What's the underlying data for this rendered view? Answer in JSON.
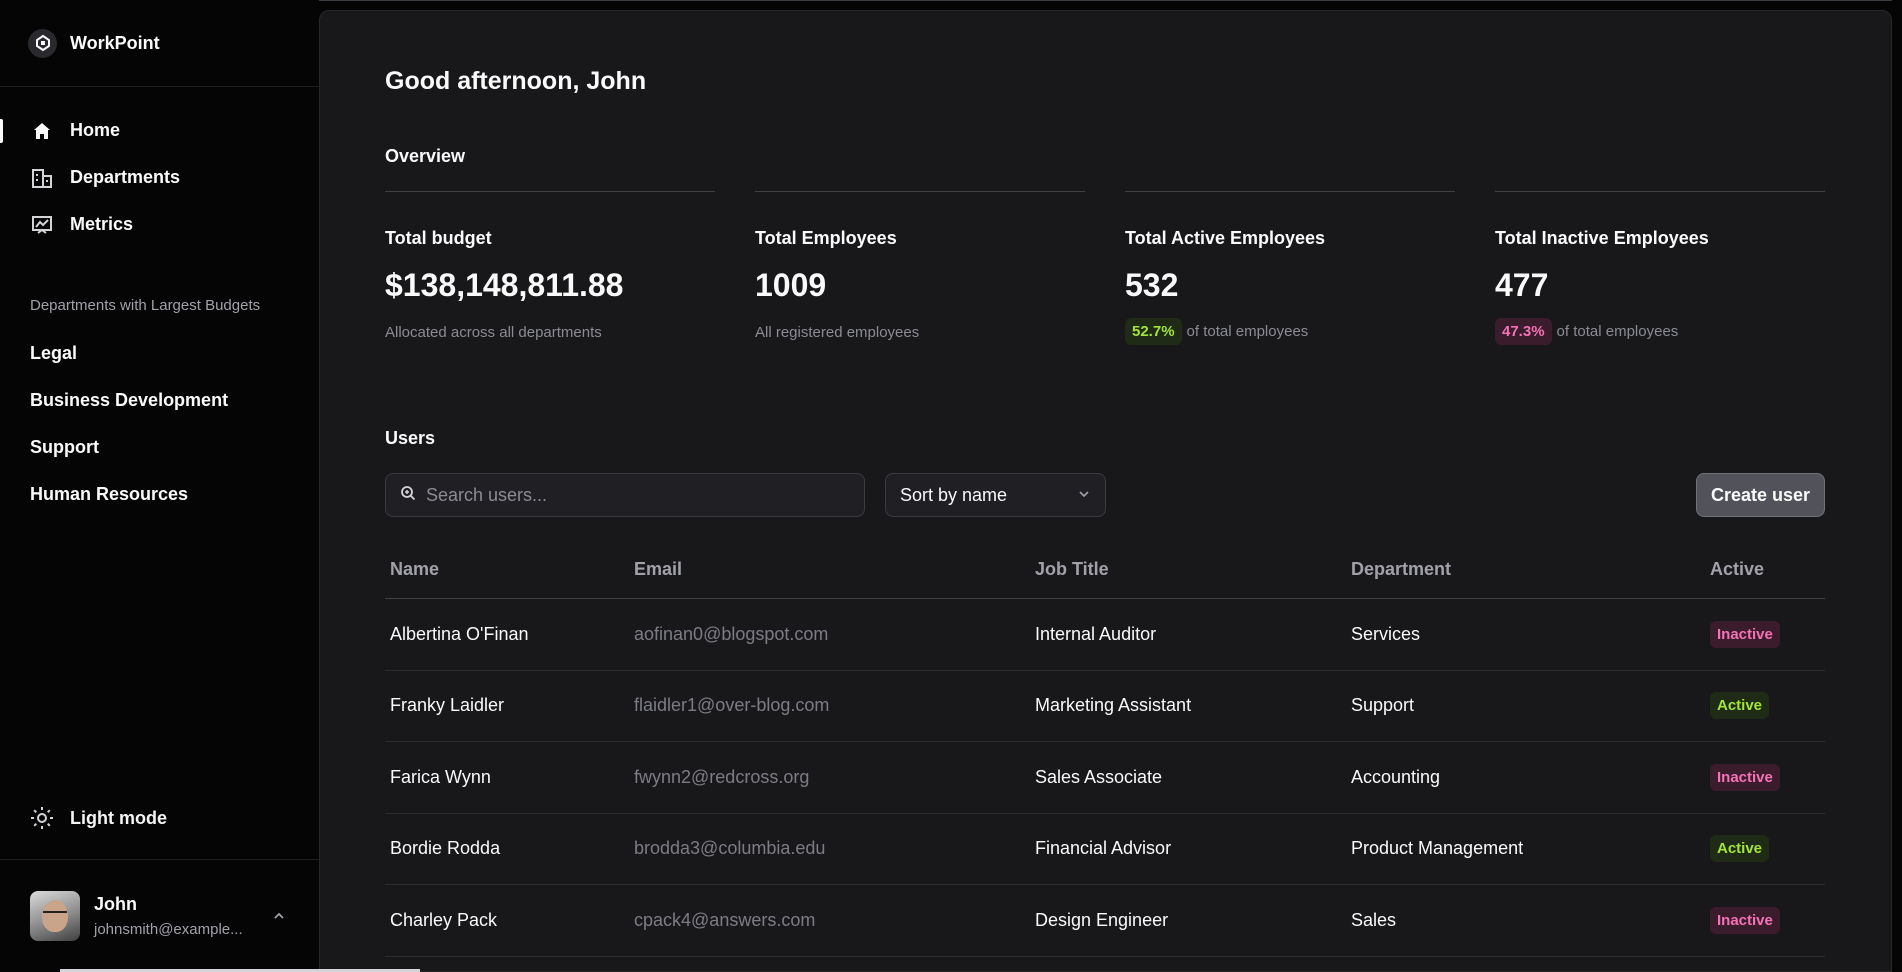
{
  "app": {
    "name": "WorkPoint"
  },
  "nav": [
    {
      "label": "Home",
      "icon": "home-icon",
      "active": true
    },
    {
      "label": "Departments",
      "icon": "building-icon",
      "active": false
    },
    {
      "label": "Metrics",
      "icon": "chart-icon",
      "active": false
    }
  ],
  "sidebar": {
    "section_title": "Departments with Largest Budgets",
    "departments": [
      "Legal",
      "Business Development",
      "Support",
      "Human Resources"
    ],
    "theme_toggle": "Light mode",
    "user": {
      "name": "John",
      "email": "johnsmith@example..."
    }
  },
  "main": {
    "greeting": "Good afternoon, John",
    "overview_title": "Overview",
    "stats": [
      {
        "label": "Total budget",
        "value": "$138,148,811.88",
        "sub": "Allocated across all departments"
      },
      {
        "label": "Total Employees",
        "value": "1009",
        "sub": "All registered employees"
      },
      {
        "label": "Total Active Employees",
        "value": "532",
        "pct": "52.7%",
        "sub": "of total employees"
      },
      {
        "label": "Total Inactive Employees",
        "value": "477",
        "pct": "47.3%",
        "sub": "of total employees"
      }
    ],
    "users_title": "Users",
    "search_placeholder": "Search users...",
    "sort_label": "Sort by name",
    "create_button": "Create user",
    "table": {
      "headers": [
        "Name",
        "Email",
        "Job Title",
        "Department",
        "Active"
      ],
      "rows": [
        {
          "name": "Albertina O'Finan",
          "email": "aofinan0@blogspot.com",
          "job": "Internal Auditor",
          "dept": "Services",
          "status": "Inactive"
        },
        {
          "name": "Franky Laidler",
          "email": "flaidler1@over-blog.com",
          "job": "Marketing Assistant",
          "dept": "Support",
          "status": "Active"
        },
        {
          "name": "Farica Wynn",
          "email": "fwynn2@redcross.org",
          "job": "Sales Associate",
          "dept": "Accounting",
          "status": "Inactive"
        },
        {
          "name": "Bordie Rodda",
          "email": "brodda3@columbia.edu",
          "job": "Financial Advisor",
          "dept": "Product Management",
          "status": "Active"
        },
        {
          "name": "Charley Pack",
          "email": "cpack4@answers.com",
          "job": "Design Engineer",
          "dept": "Sales",
          "status": "Inactive"
        }
      ]
    }
  },
  "colors": {
    "active_badge": "#a3e635",
    "inactive_badge": "#f472b6",
    "panel_bg": "#18181b"
  }
}
